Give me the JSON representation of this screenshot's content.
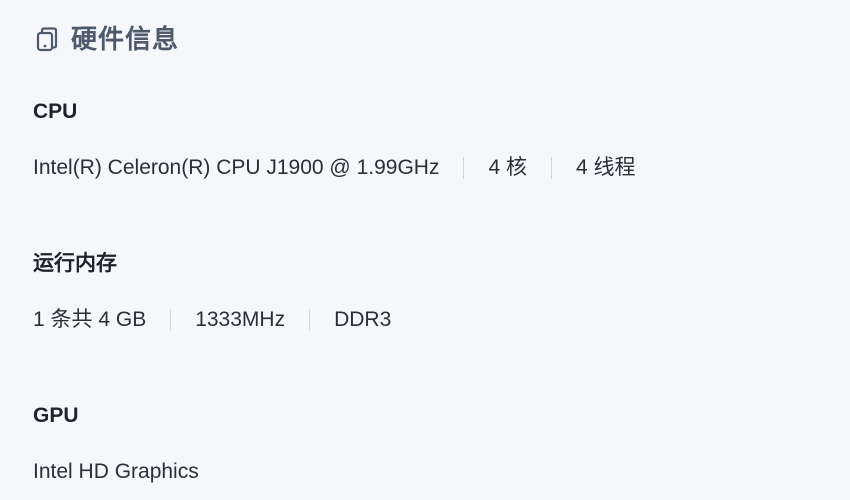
{
  "header": {
    "title": "硬件信息",
    "icon": "device-icon"
  },
  "cpu": {
    "title": "CPU",
    "model": "Intel(R) Celeron(R) CPU J1900 @ 1.99GHz",
    "cores": "4 核",
    "threads": "4 线程"
  },
  "memory": {
    "title": "运行内存",
    "capacity": "1 条共 4 GB",
    "frequency": "1333MHz",
    "type": "DDR3"
  },
  "gpu": {
    "title": "GPU",
    "model": "Intel HD Graphics"
  },
  "colors": {
    "background": "#f6f7fb",
    "header_text": "#4e5a6b",
    "body_text": "#2b2f36",
    "separator": "#cfd5de"
  }
}
